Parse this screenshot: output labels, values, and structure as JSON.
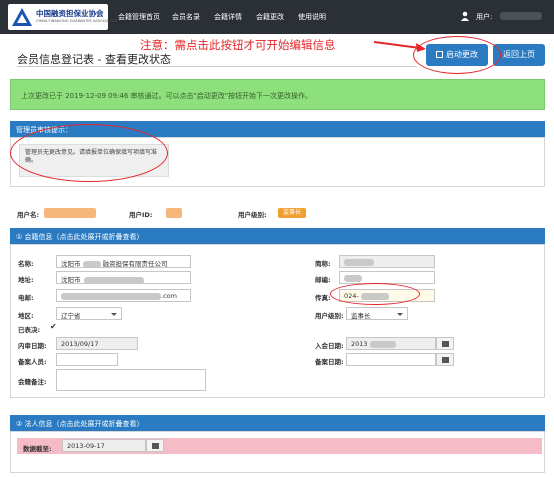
{
  "header": {
    "logo_cn": "中国融资担保业协会",
    "logo_en": "CHINA FINANCING GUARANTEE ASSOCIATION",
    "nav": [
      "会籍管理首页",
      "会员名录",
      "会籍详情",
      "会籍更改",
      "使用说明"
    ],
    "user_label": "用户:"
  },
  "page": {
    "title": "会员信息登记表 - 查看更改状态",
    "annotation": "注意：需点击此按钮才可开始编辑信息",
    "btn_start": "启动更改",
    "btn_back": "返回上页"
  },
  "alert": {
    "text": "上次更改已于 2019-12-09 09:46 审核通过。可以点击\"启动更改\"按钮开始下一次更改操作。"
  },
  "admin_panel": {
    "title": "管理员审核提示：",
    "note": "管理员无更改意见。请填报单位确保填写项填写准确。"
  },
  "user_info": {
    "username_label": "用户名:",
    "userid_label": "用户ID:",
    "level_label": "用户级别:",
    "level_value": "监事长"
  },
  "member_panel": {
    "title": "① 会籍信息（点击此处展开或折叠查看）",
    "name_label": "名称:",
    "name_value_prefix": "沈阳市",
    "name_value_suffix": "融资担保有限责任公司",
    "short_label": "简称:",
    "addr_label": "地址:",
    "addr_value": "沈阳市",
    "zip_label": "邮编:",
    "email_label": "电邮:",
    "email_suffix": ".com",
    "fax_label": "传真:",
    "fax_value": "024-",
    "region_label": "地区:",
    "region_value": "辽宁省",
    "userlevel_label": "用户级别:",
    "userlevel_value": "监事长",
    "confirmed_label": "已表决:",
    "join_label": "内审日期:",
    "join_value": "2013/09/17",
    "entry_label": "入会日期:",
    "entry_value": "2013",
    "filer_label": "备案人员:",
    "filedate_label": "备案日期:",
    "remark_label": "会籍备注:"
  },
  "legal_panel": {
    "title": "② 法人信息（点击此处展开或折叠查看）",
    "deadline_label": "数据截至:",
    "deadline_value": "2013-09-17"
  },
  "colors": {
    "primary": "#2a7bc2",
    "alert_green": "#8ee07c",
    "annotation_red": "#e4262b",
    "badge_orange": "#f0a030"
  }
}
